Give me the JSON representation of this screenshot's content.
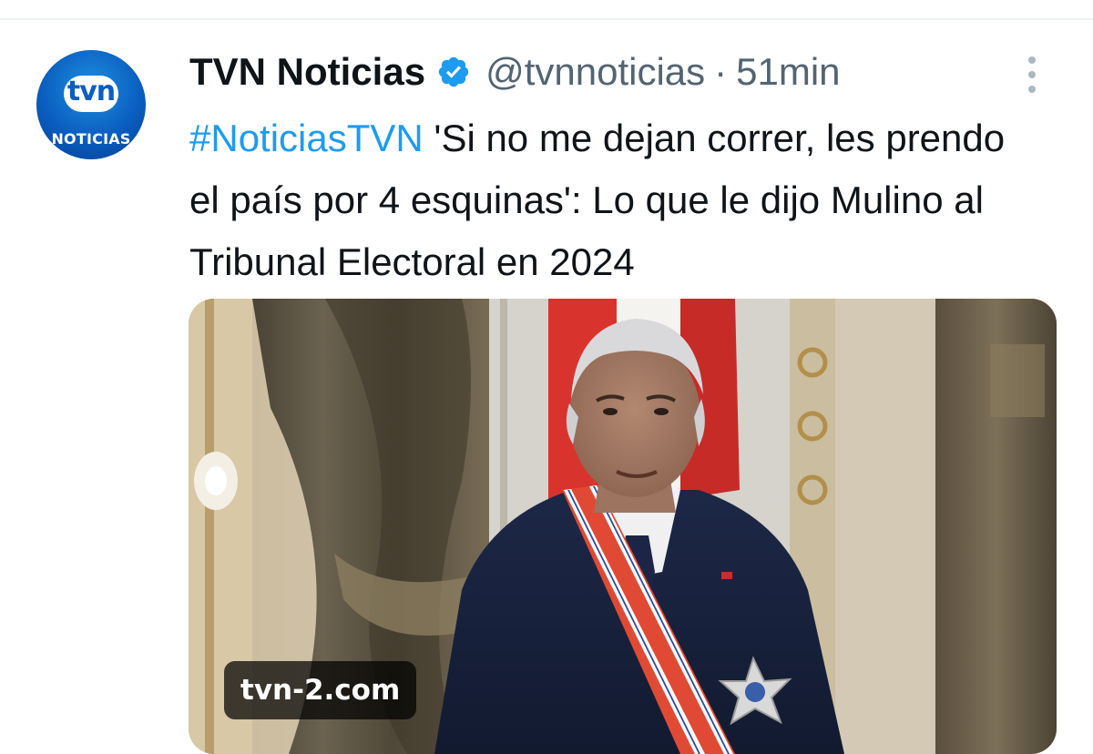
{
  "tweet": {
    "avatar": {
      "logo_top": "tvn",
      "logo_bottom": "NOTICIAS"
    },
    "author_name": "TVN Noticias",
    "verified_icon": "verified-badge-icon",
    "handle": "@tvnnoticias",
    "separator": "·",
    "time": "51min",
    "more_icon": "more-vertical-icon",
    "hashtag": "#NoticiasTVN",
    "text": " 'Si no me dejan correr, les prendo el país por 4 esquinas': Lo que le dijo Mulino al Tribunal Electoral en 2024",
    "media": {
      "source_label": "tvn-2.com"
    }
  },
  "colors": {
    "accent": "#1d9bf0",
    "text_primary": "#0f1419",
    "text_secondary": "#536471",
    "brand_blue": "#0a5ec0"
  }
}
